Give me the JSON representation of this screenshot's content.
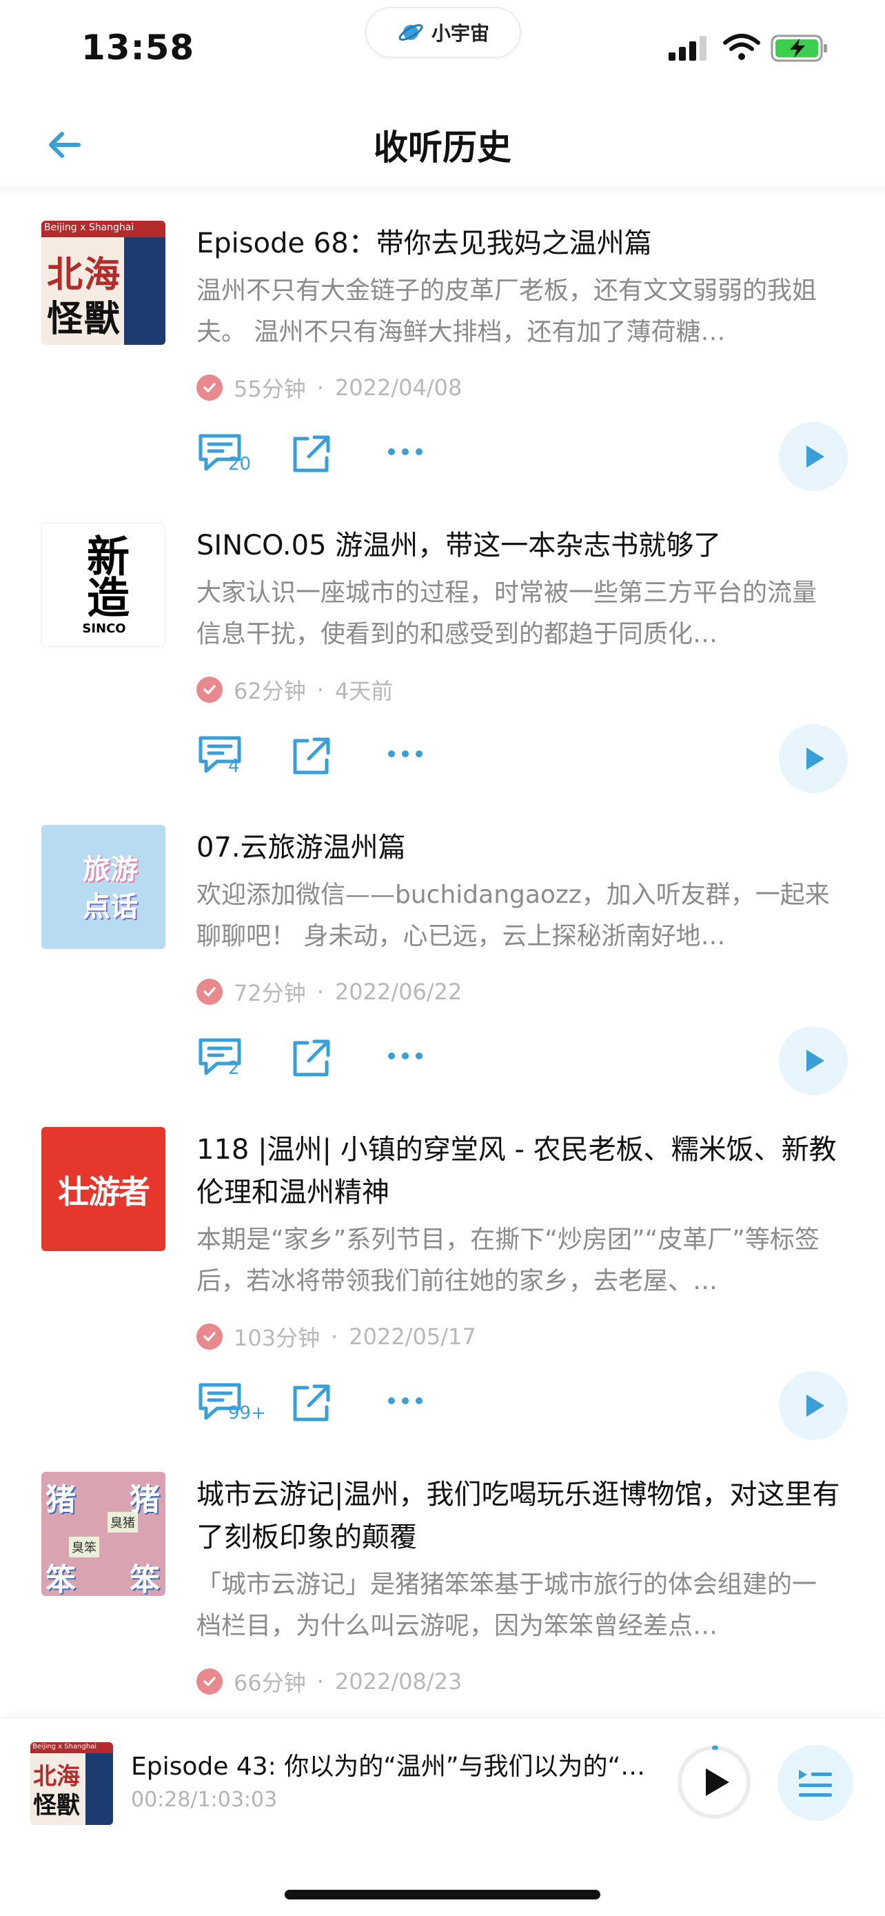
{
  "status_bar": {
    "time": "13:58",
    "app_name": "小宇宙"
  },
  "nav": {
    "title": "收听历史",
    "back_icon": "arrow-left-icon"
  },
  "colors": {
    "accent": "#3a9fd6",
    "check": "#e8898d",
    "meta": "#b8b8b8",
    "desc": "#8b8b8b"
  },
  "episodes": [
    {
      "title": "Episode 68：带你去见我妈之温州篇",
      "description": "温州不只有大金链子的皮革厂老板，还有文文弱弱的我姐夫。 温州不只有海鲜大排档，还有加了薄荷糖…",
      "duration": "55分钟",
      "date": "2022/04/08",
      "comments": "20",
      "cover": {
        "tag": "Beijing x Shanghai",
        "line1": "北海",
        "line2": "怪獸"
      }
    },
    {
      "title": "SINCO.05 游温州，带这一本杂志书就够了",
      "description": "大家认识一座城市的过程，时常被一些第三方平台的流量信息干扰，使看到的和感受到的都趋于同质化…",
      "duration": "62分钟",
      "date": "4天前",
      "comments": "4",
      "cover": {
        "line1": "新造",
        "line2": "SINCO"
      }
    },
    {
      "title": "07.云旅游温州篇",
      "description": "欢迎添加微信——buchidangaozz，加入听友群，一起来聊聊吧！ 身未动，心已远，云上探秘浙南好地…",
      "duration": "72分钟",
      "date": "2022/06/22",
      "comments": "2",
      "cover": {
        "line1": "旅游",
        "line2": "点话"
      }
    },
    {
      "title": "118 |温州| 小镇的穿堂风 - 农民老板、糯米饭、新教伦理和温州精神",
      "description": "本期是“家乡”系列节目，在撕下“炒房团”“皮革厂”等标签后，若冰将带领我们前往她的家乡，去老屋、…",
      "duration": "103分钟",
      "date": "2022/05/17",
      "comments": "99+",
      "cover": {
        "line1": "壮游者"
      }
    },
    {
      "title": "城市云游记|温州，我们吃喝玩乐逛博物馆，对这里有了刻板印象的颠覆",
      "description": "「城市云游记」是猪猪笨笨基于城市旅行的体会组建的一档栏目，为什么叫云游呢，因为笨笨曾经差点…",
      "duration": "66分钟",
      "date": "2022/08/23",
      "comments": "",
      "cover": {
        "tl": "猪",
        "tr": "猪",
        "bl": "笨",
        "br": "笨",
        "sticker1": "臭猪",
        "sticker2": "臭笨"
      }
    }
  ],
  "player": {
    "title": "Episode 43: 你以为的“温州”与我们以为的“…",
    "time": "00:28/1:03:03",
    "cover": {
      "tag": "Beijing x Shanghai",
      "line1": "北海",
      "line2": "怪獸"
    }
  }
}
